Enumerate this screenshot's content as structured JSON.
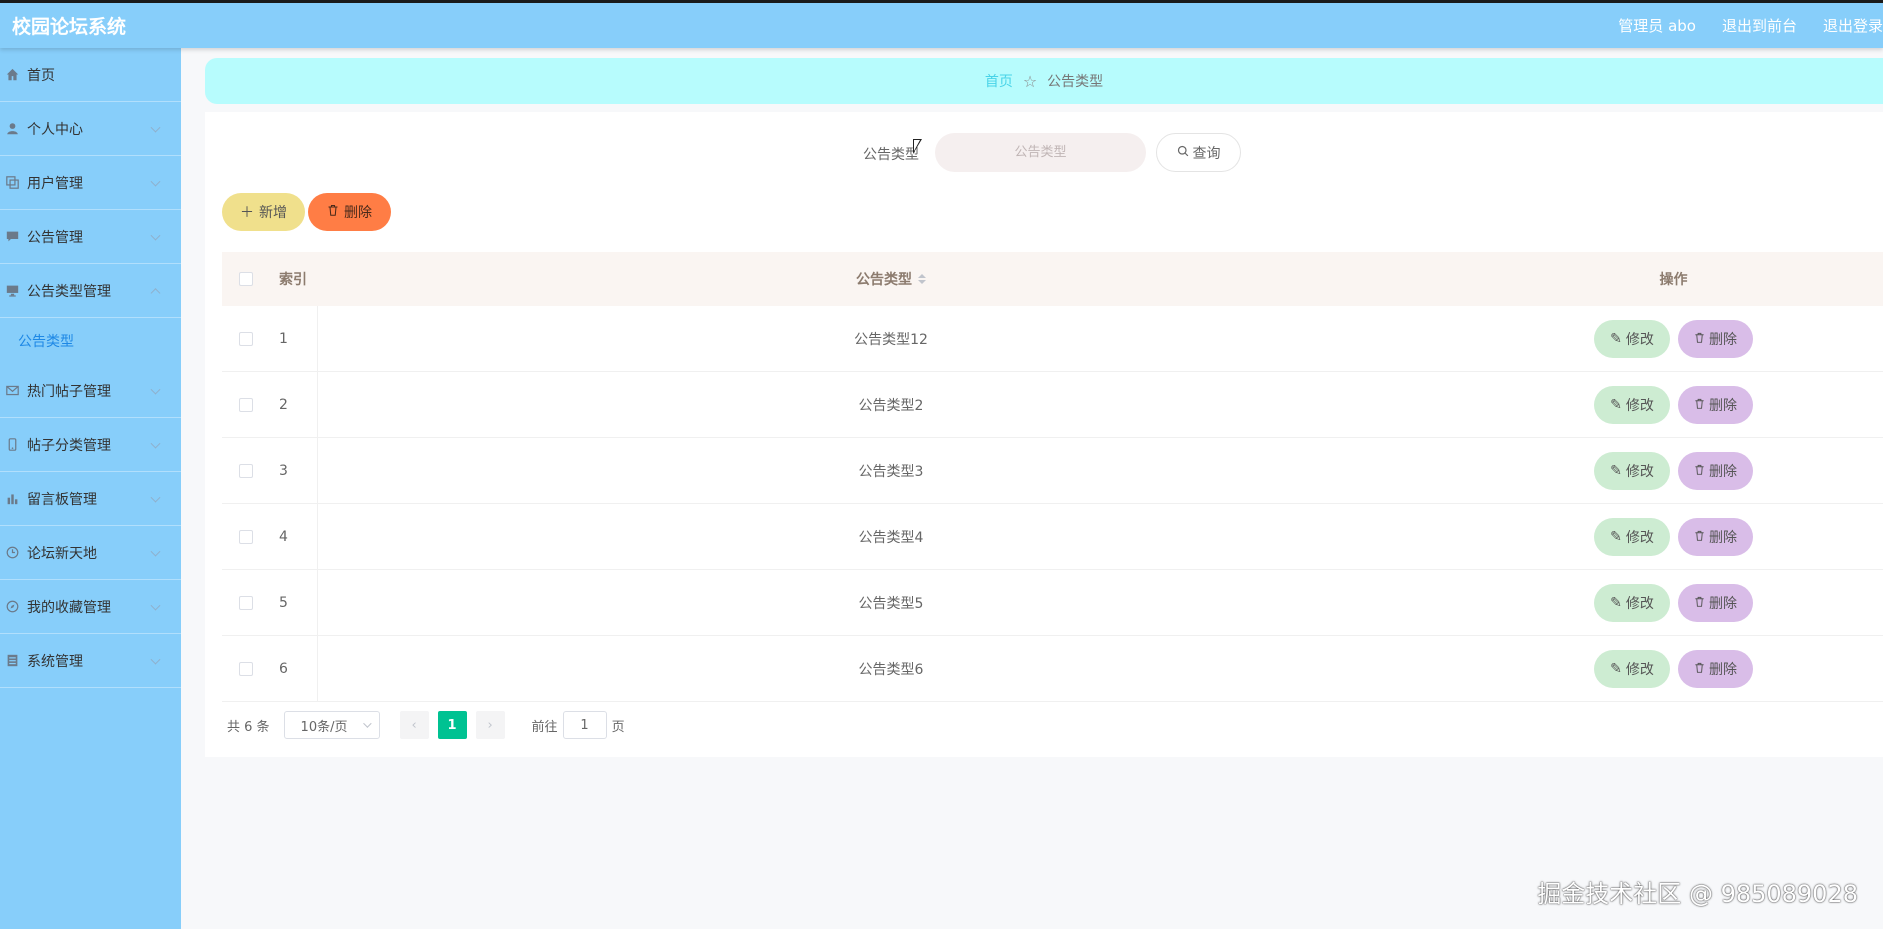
{
  "app": {
    "title": "校园论坛系统",
    "user_label": "管理员 abo",
    "to_frontend": "退出到前台",
    "logout": "退出登录"
  },
  "sidebar": {
    "items": [
      {
        "label": "首页",
        "icon": "home-icon",
        "expandable": false
      },
      {
        "label": "个人中心",
        "icon": "user-icon",
        "expandable": true
      },
      {
        "label": "用户管理",
        "icon": "copy-icon",
        "expandable": true
      },
      {
        "label": "公告管理",
        "icon": "message-icon",
        "expandable": true
      },
      {
        "label": "公告类型管理",
        "icon": "monitor-icon",
        "expandable": true,
        "expanded": true
      },
      {
        "label": "热门帖子管理",
        "icon": "mail-icon",
        "expandable": true
      },
      {
        "label": "帖子分类管理",
        "icon": "phone-icon",
        "expandable": true
      },
      {
        "label": "留言板管理",
        "icon": "chart-icon",
        "expandable": true
      },
      {
        "label": "论坛新天地",
        "icon": "clock-icon",
        "expandable": true
      },
      {
        "label": "我的收藏管理",
        "icon": "compass-icon",
        "expandable": true
      },
      {
        "label": "系统管理",
        "icon": "list-icon",
        "expandable": true
      }
    ],
    "subitem": "公告类型"
  },
  "breadcrumb": {
    "home": "首页",
    "current": "公告类型"
  },
  "search": {
    "label": "公告类型",
    "placeholder": "公告类型",
    "button": "查询"
  },
  "actions": {
    "add": "新增",
    "delete": "删除"
  },
  "table": {
    "headers": {
      "index": "索引",
      "type": "公告类型",
      "ops": "操作"
    },
    "rows": [
      {
        "index": "1",
        "type": "公告类型12"
      },
      {
        "index": "2",
        "type": "公告类型2"
      },
      {
        "index": "3",
        "type": "公告类型3"
      },
      {
        "index": "4",
        "type": "公告类型4"
      },
      {
        "index": "5",
        "type": "公告类型5"
      },
      {
        "index": "6",
        "type": "公告类型6"
      }
    ],
    "edit_label": "修改",
    "delete_label": "删除"
  },
  "pager": {
    "total": "共 6 条",
    "page_size": "10条/页",
    "current": "1",
    "goto_label": "前往",
    "goto_value": "1",
    "page_unit": "页"
  },
  "watermark": "掘金技术社区 @ 985089028",
  "colors": {
    "topbar": "#87cefa",
    "sidebar": "#87cefa",
    "breadcrumb": "#b7fcfd",
    "add_button": "#f0e08c",
    "delete_button": "#ff7d45",
    "edit_button": "#cdecd2",
    "row_delete_button": "#d9bde8",
    "page_active": "#00c292"
  }
}
